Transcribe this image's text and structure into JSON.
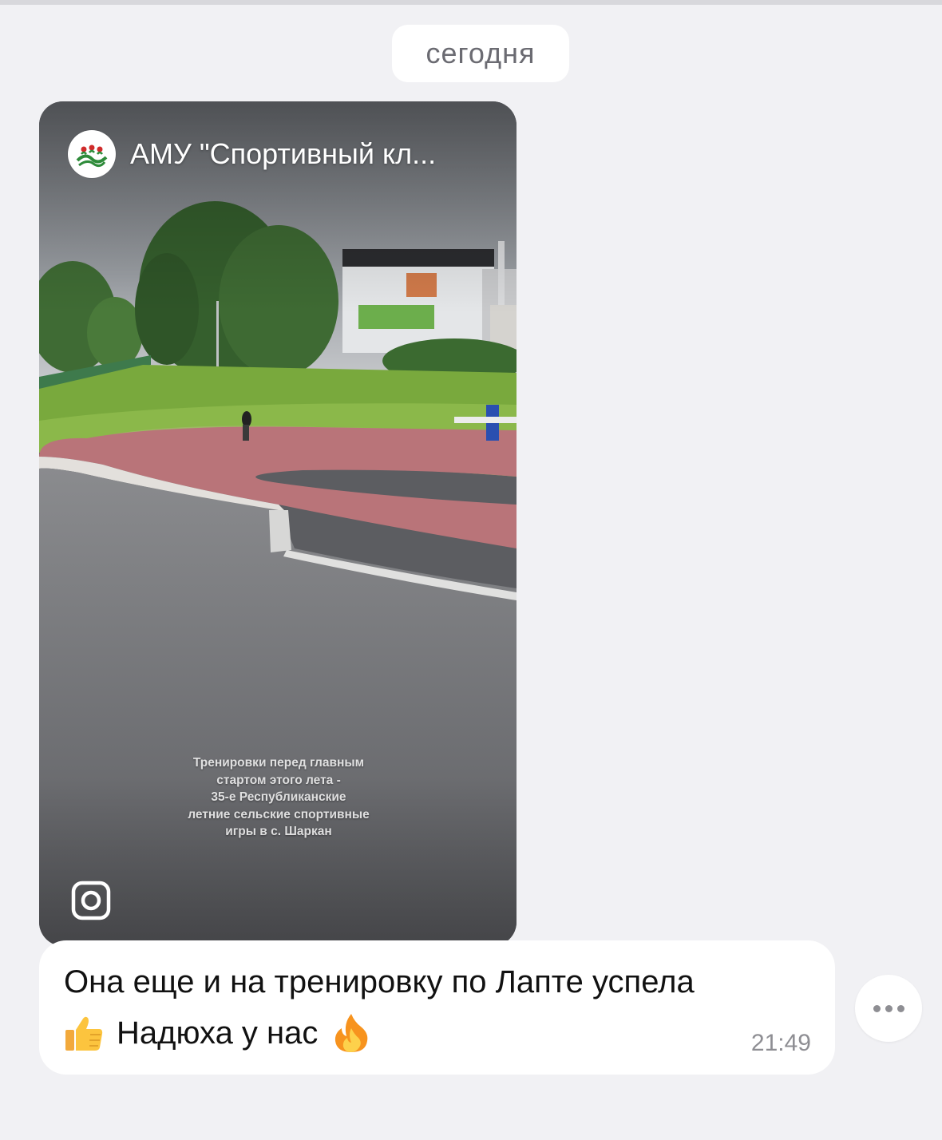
{
  "chat": {
    "date_separator": "сегодня"
  },
  "story": {
    "author": "АМУ \"Спортивный кл...",
    "overlay_text": "Тренировки перед главным\nстартом этого лета -\n35-е Республиканские\nлетние сельские спортивные\nигры в с. Шаркан",
    "avatar_icon": "club-logo-icon",
    "source_icon": "instagram-icon"
  },
  "message": {
    "line1": "Она еще и на тренировку по Лапте успела",
    "line2_text": "Надюха у нас",
    "emoji_before": "thumbs-up-emoji",
    "emoji_after": "fire-emoji",
    "time": "21:49"
  },
  "actions": {
    "more_icon": "more-horizontal-icon"
  },
  "colors": {
    "background": "#f1f1f4",
    "bubble": "#ffffff",
    "timestamp": "#8e8e93"
  }
}
